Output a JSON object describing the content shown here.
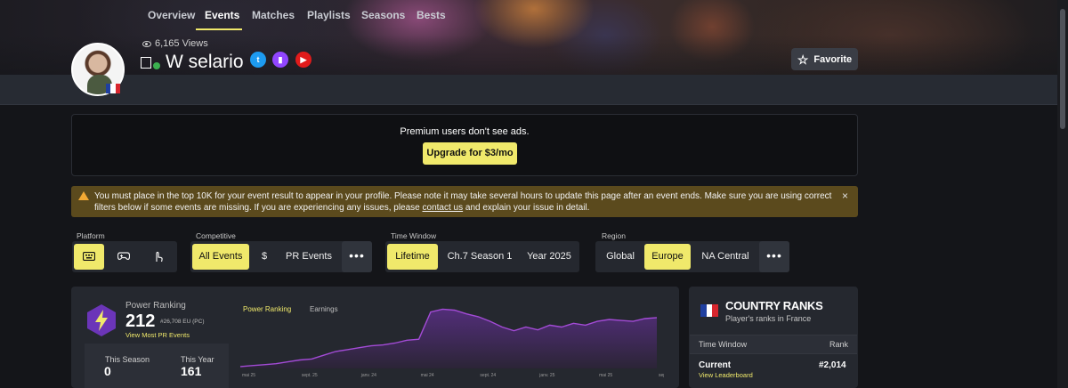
{
  "profile": {
    "views": "6,165 Views",
    "name": "W selario",
    "country_flag": "france-flag",
    "socials": [
      "twitter-icon",
      "twitch-icon",
      "youtube-icon"
    ]
  },
  "header": {
    "favorite_label": "Favorite"
  },
  "nav": {
    "items": [
      "Overview",
      "Events",
      "Matches",
      "Playlists",
      "Seasons",
      "Bests"
    ],
    "active": "Events"
  },
  "premium": {
    "text": "Premium users don't see ads.",
    "button": "Upgrade for $3/mo"
  },
  "warning": {
    "text_before": "You must place in the top 10K for your event result to appear in your profile. Please note it may take several hours to update this page after an event ends. Make sure you are using correct filters below if some events are missing. If you are experiencing any issues, please ",
    "link": "contact us",
    "text_after": " and explain your issue in detail.",
    "close": "×"
  },
  "filters": {
    "platform": {
      "label": "Platform",
      "options": [
        "keyboard-icon",
        "gamepad-icon",
        "touch-icon"
      ],
      "active": "keyboard-icon"
    },
    "competitive": {
      "label": "Competitive",
      "options": [
        "All Events",
        "$",
        "PR Events"
      ],
      "active": "All Events",
      "more": "•••"
    },
    "time_window": {
      "label": "Time Window",
      "options": [
        "Lifetime",
        "Ch.7 Season 1",
        "Year 2025"
      ],
      "active": "Lifetime"
    },
    "region": {
      "label": "Region",
      "options": [
        "Global",
        "Europe",
        "NA Central"
      ],
      "active": "Europe",
      "more": "•••"
    }
  },
  "power_ranking": {
    "title": "Power Ranking",
    "value": "212",
    "sub": "#26,708 EU (PC)",
    "link": "View Most PR Events",
    "this_season_label": "This Season",
    "this_season_value": "0",
    "this_year_label": "This Year",
    "this_year_value": "161",
    "tabs": [
      "Power Ranking",
      "Earnings"
    ],
    "active_tab": "Power Ranking"
  },
  "chart_data": {
    "type": "area",
    "x_ticks": [
      "mai 25",
      "sept. 25",
      "janv. 24",
      "mai 24",
      "sept. 24",
      "janv. 25",
      "mai 25",
      "sept. 25"
    ],
    "values": [
      2,
      3,
      4,
      5,
      7,
      9,
      10,
      14,
      18,
      20,
      22,
      24,
      25,
      27,
      30,
      31,
      60,
      63,
      62,
      58,
      55,
      50,
      44,
      40,
      44,
      41,
      46,
      44,
      48,
      46,
      50,
      52,
      51,
      50,
      53,
      54
    ],
    "line_color": "#a34bd6"
  },
  "country_ranks": {
    "title": "COUNTRY RANKS",
    "subtitle": "Player's ranks in France",
    "col_time": "Time Window",
    "col_rank": "Rank",
    "current_label": "Current",
    "current_rank": "#2,014",
    "link": "View Leaderboard"
  }
}
